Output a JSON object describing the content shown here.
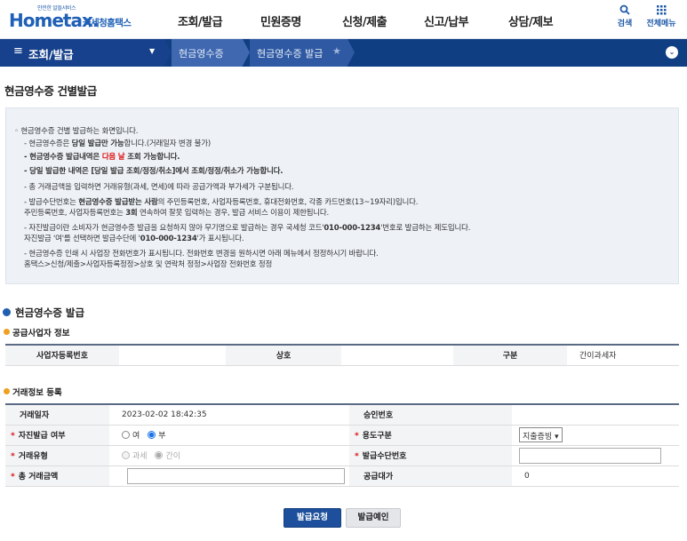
{
  "header": {
    "logo_small": "안전한 알뜰서비스",
    "logo_main": "Hometax.",
    "logo_kr": "국세청홈택스",
    "nav": [
      "조회/발급",
      "민원증명",
      "신청/제출",
      "신고/납부",
      "상담/제보"
    ],
    "search_label": "검색",
    "allmenu_label": "전체메뉴"
  },
  "navbar": {
    "menu_label": "조회/발급",
    "crumb1": "현금영수증",
    "crumb2": "현금영수증 발급"
  },
  "page_title": "현금영수증 건별발급",
  "info": {
    "l1": "◦ 현금영수증 건별 발급하는 화면입니다.",
    "l2a": "- 현금영수증은 ",
    "l2b": "당일 발급만 가능",
    "l2c": "합니다.(거래일자 변경 불가)",
    "l3a": "- 현금영수증 발급내역은 ",
    "l3b": "다음 날",
    "l3c": " 조회 가능합니다.",
    "l4a": "- 당일 발급한 내역은 [당일 발급 조회/정정/취소]에서 조회/정정/취소가 가능합니다.",
    "l5": "- 총 거래금액을 입력하면 거래유형(과세, 면세)에 따라 공급가액과 부가세가 구분됩니다.",
    "l6a": "- 발급수단번호는 ",
    "l6b": "현금영수증 발급받는 사람",
    "l6c": "의  주민등록번호, 사업자등록번호, 휴대전화번호, 각종 카드번호(13~19자리)입니다.",
    "l7a": "  주민등록번호, 사업자등록번호는 ",
    "l7b": "3회",
    "l7c": " 연속하여 잘못 입력하는 경우, 발급 서비스 이용이 제한됩니다.",
    "l8a": "- 자진발급이란 소비자가 현금영수증 발급을 요청하지 않아 무기명으로 발급하는 경우 국세청 코드'",
    "l8b": "010-000-1234",
    "l8c": "'번호로 발급하는 제도입니다.",
    "l9a": "  자진발급 '여'를 선택하면 발급수단에 '",
    "l9b": "010-000-1234",
    "l9c": "'가 표시됩니다.",
    "l10": "- 현금영수증 인쇄 시 사업장 전화번호가 표시됩니다. 전화번호 변경을 원하시면 아래 메뉴에서 정정하시기 바랍니다.",
    "l11": "  홈택스>신청/제출>사업자등록정정>상호 및 연락처 정정>사업장 전화번호 정정"
  },
  "section_title": "현금영수증 발급",
  "supplier": {
    "title": "공급사업자 정보",
    "brn_label": "사업자등록번호",
    "brn_value": "",
    "name_label": "상호",
    "name_value": "",
    "type_label": "구분",
    "type_value": "간이과세자"
  },
  "trade": {
    "title": "거래정보 등록",
    "date_label": "거래일자",
    "date_value": "2023-02-02 18:42:35",
    "approval_label": "승인번호",
    "self_label": "자진발급 여부",
    "self_yes": "여",
    "self_no": "부",
    "usage_label": "용도구분",
    "usage_selected": "지출증빙",
    "type_label": "거래유형",
    "type_tax": "과세",
    "type_simple": "간이",
    "means_label": "발급수단번호",
    "total_label": "총 거래금액",
    "supply_label": "공급대가",
    "supply_value": "0"
  },
  "buttons": {
    "request": "발급요청",
    "guide": "발급예인"
  },
  "colors": {
    "navbar": "#0f3e83",
    "crumb": "#3f68b0",
    "primary_button": "#1d4f9c",
    "required": "#dd1111"
  }
}
